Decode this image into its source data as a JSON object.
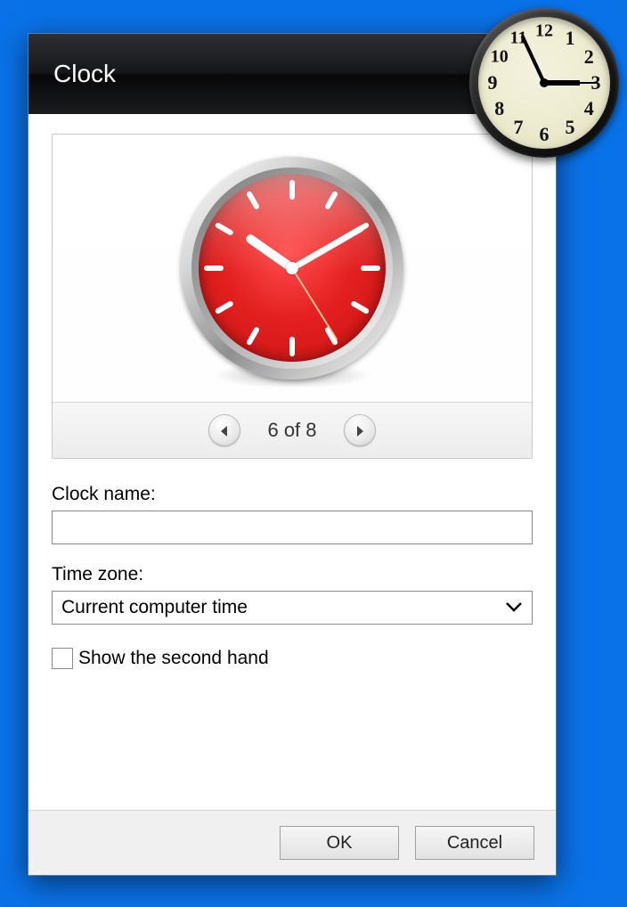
{
  "dialog": {
    "title": "Clock",
    "pager": {
      "current": 6,
      "total": 8,
      "label": "6 of 8"
    },
    "form": {
      "clock_name_label": "Clock name:",
      "clock_name_value": "",
      "timezone_label": "Time zone:",
      "timezone_value": "Current computer time",
      "second_hand_label": "Show the second hand",
      "second_hand_checked": false
    },
    "buttons": {
      "ok": "OK",
      "cancel": "Cancel"
    },
    "preview_clock": {
      "face_color": "#e42020",
      "hour_angle": 305,
      "minute_angle": 60,
      "second_angle": 148
    }
  },
  "gadget_clock": {
    "hour_angle": 90,
    "minute_angle": 335,
    "second_angle": 90
  }
}
